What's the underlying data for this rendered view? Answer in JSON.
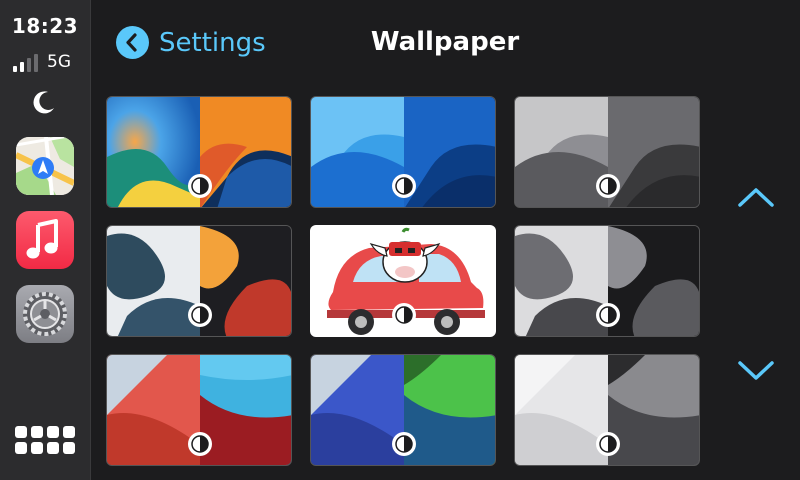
{
  "status": {
    "time": "18:23",
    "network": "5G",
    "signal_bars": 2,
    "signal_bars_total": 4
  },
  "sidebar": {
    "apps": [
      {
        "name": "Maps",
        "icon": "maps-icon"
      },
      {
        "name": "Music",
        "icon": "music-icon"
      },
      {
        "name": "Settings",
        "icon": "settings-gear-icon"
      }
    ],
    "home_icon": "app-grid-icon"
  },
  "header": {
    "back_label": "Settings",
    "title": "Wallpaper"
  },
  "wallpapers": [
    {
      "id": "bloom-color",
      "icon": "appearance-mode-icon"
    },
    {
      "id": "bloom-blue",
      "icon": "appearance-mode-icon"
    },
    {
      "id": "bloom-gray",
      "icon": "appearance-mode-icon"
    },
    {
      "id": "blob-orange",
      "icon": "appearance-mode-icon"
    },
    {
      "id": "cow-car",
      "icon": "appearance-mode-icon"
    },
    {
      "id": "blob-gray",
      "icon": "appearance-mode-icon"
    },
    {
      "id": "wave-red",
      "icon": "appearance-mode-icon"
    },
    {
      "id": "wave-green",
      "icon": "appearance-mode-icon"
    },
    {
      "id": "wave-silver",
      "icon": "appearance-mode-icon"
    }
  ],
  "colors": {
    "accent": "#5ac8fa",
    "background": "#1c1c1e",
    "sidebar": "#2c2c2e"
  }
}
